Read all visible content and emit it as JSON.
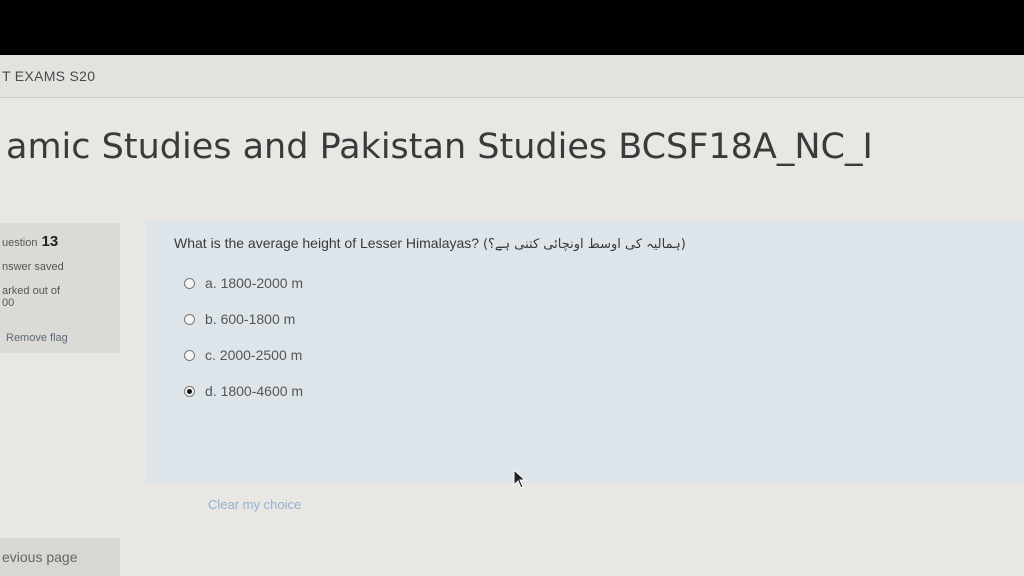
{
  "header": {
    "course_bar": "T EXAMS S20"
  },
  "page": {
    "title": "amic Studies and Pakistan Studies BCSF18A_NC_I"
  },
  "question_info": {
    "label": "uestion",
    "number": "13",
    "status": "nswer saved",
    "marks_line1": "arked out of",
    "marks_line2": "00",
    "flag_button": "Remove flag"
  },
  "question": {
    "text": "What is the average height of Lesser Himalayas?",
    "urdu_text": "(ہمالیہ کی اوسط اونچائی کتنی ہے؟)",
    "options": [
      {
        "label": "a. 1800-2000 m",
        "selected": false
      },
      {
        "label": "b. 600-1800 m",
        "selected": false
      },
      {
        "label": "c. 2000-2500 m",
        "selected": false
      },
      {
        "label": "d. 1800-4600 m",
        "selected": true
      }
    ],
    "clear_choice": "Clear my choice"
  },
  "navigation": {
    "previous": "evious page"
  },
  "icons": {
    "cursor": "mouse-pointer-icon"
  }
}
